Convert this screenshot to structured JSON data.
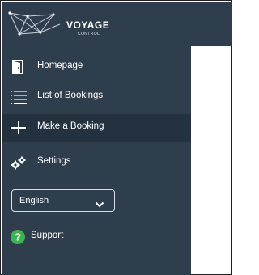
{
  "brand": {
    "title": "VOYAGE",
    "subtitle": "CONTROL"
  },
  "sidebar": {
    "items": [
      {
        "label": "Homepage",
        "icon": "door-icon"
      },
      {
        "label": "List of Bookings",
        "icon": "list-icon"
      },
      {
        "label": "Make a Booking",
        "icon": "plus-icon",
        "active": true
      },
      {
        "label": "Settings",
        "icon": "gears-icon"
      }
    ],
    "language": {
      "selected": "English"
    },
    "support": {
      "label": "Support",
      "icon": "question-circle-icon"
    }
  },
  "colors": {
    "sidebar_bg": "#2f3e4c",
    "active_bg": "#243240",
    "text": "#ffffff",
    "support_icon": "#3fb34f"
  }
}
